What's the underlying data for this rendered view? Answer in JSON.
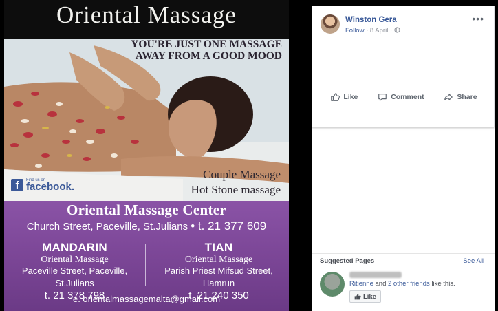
{
  "flyer": {
    "title": "Oriental Massage",
    "tagline_line1": "YOU'RE JUST ONE MASSAGE",
    "tagline_line2": "AWAY FROM A GOOD MOOD",
    "service1": "Couple Massage",
    "service2": "Hot Stone massage",
    "facebook_small": "Find us on",
    "facebook_word": "facebook.",
    "center_name": "Oriental Massage Center",
    "center_address": "Church Street, Paceville, St.Julians",
    "center_phone": "• t. 21 377 609",
    "branch_left": {
      "name": "MANDARIN",
      "sub": "Oriental Massage",
      "address": "Paceville Street, Paceville, St.Julians",
      "phone": "t. 21 378 798"
    },
    "branch_right": {
      "name": "TIAN",
      "sub": "Oriental Massage",
      "address": "Parish Priest Mifsud Street, Hamrun",
      "phone": "t. 21 240 350"
    },
    "email": "e. orientalmassagemalta@gmail.com"
  },
  "post": {
    "author": "Winston Gera",
    "follow": "Follow",
    "date": "· 8 April ·",
    "more": "•••",
    "actions": {
      "like": "Like",
      "comment": "Comment",
      "share": "Share"
    }
  },
  "suggested": {
    "title": "Suggested Pages",
    "see_all": "See All",
    "friend_name": "Ritienne",
    "and_text": " and ",
    "other_friends": "2 other friends",
    "like_this": " like this.",
    "like_button": "Like"
  },
  "colors": {
    "facebook_blue": "#385898",
    "flyer_purple": "#7a4595"
  }
}
